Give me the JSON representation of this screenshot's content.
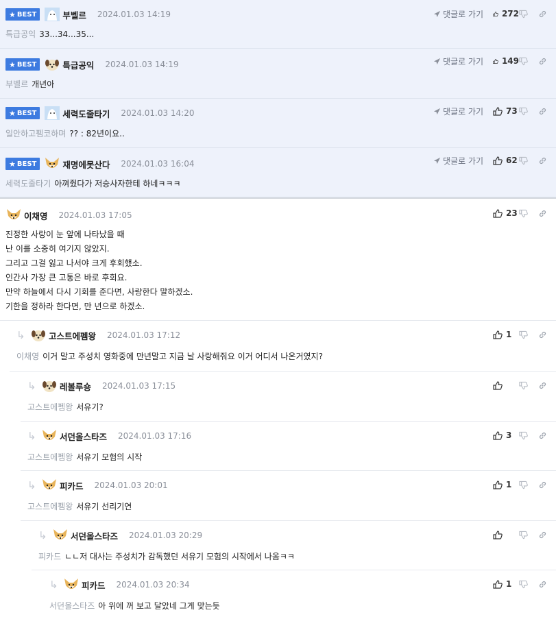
{
  "labels": {
    "best": "BEST",
    "goto": "댓글로 가기"
  },
  "colors": {
    "best_bg": "#eef2fb",
    "badge": "#3d7be0",
    "mention": "#9aa1ab"
  },
  "comments": [
    {
      "best": true,
      "avatar": "blue-dog",
      "nick": "부벨르",
      "date": "2024.01.03 14:19",
      "mention": "특급공익",
      "text": "33...34...35...",
      "likes": "272"
    },
    {
      "best": true,
      "avatar": "puppy",
      "nick": "특급공익",
      "date": "2024.01.03 14:19",
      "mention": "부벨르",
      "text": "개년아",
      "likes": "149"
    },
    {
      "best": true,
      "avatar": "blue-dog",
      "nick": "세력도줄타기",
      "date": "2024.01.03 14:20",
      "mention": "일안하고펨코하며",
      "text": "?? : 82년이요..",
      "likes": "73"
    },
    {
      "best": true,
      "avatar": "fox",
      "nick": "재명에못산다",
      "date": "2024.01.03 16:04",
      "mention": "세력도줄타기",
      "text": "아껴줬다가 저승사자한테 하네ㅋㅋㅋ",
      "likes": "62"
    },
    {
      "best": false,
      "avatar": "fox",
      "nick": "이채영",
      "date": "2024.01.03 17:05",
      "mention": "",
      "text": "진정한 사랑이 눈 앞에 나타났을 때\n난 이를 소중히 여기지 않았지.\n그리고 그걸 잃고 나서야 크게 후회했소.\n인간사 가장 큰 고통은 바로 후회요.\n만약 하늘에서 다시 기회를 준다면, 사랑한다 말하겠소.\n기한을 정하라 한다면, 만 년으로 하겠소.",
      "likes": "23"
    },
    {
      "best": false,
      "avatar": "puppy",
      "nick": "고스트에펨왕",
      "date": "2024.01.03 17:12",
      "mention": "이채영",
      "text": "이거 말고 주성치 영화중에 만년말고 지금 날 사랑해줘요 이거 어디서 나온거였지?",
      "likes": "1"
    },
    {
      "best": false,
      "avatar": "puppy",
      "nick": "레볼루숑",
      "date": "2024.01.03 17:15",
      "mention": "고스트에펨왕",
      "text": "서유기?",
      "likes": ""
    },
    {
      "best": false,
      "avatar": "fox",
      "nick": "서던올스타즈",
      "date": "2024.01.03 17:16",
      "mention": "고스트에펨왕",
      "text": "서유기 모험의 시작",
      "likes": "3"
    },
    {
      "best": false,
      "avatar": "fox",
      "nick": "피카드",
      "date": "2024.01.03 20:01",
      "mention": "고스트에펨왕",
      "text": "서유기 선리기연",
      "likes": "1"
    },
    {
      "best": false,
      "avatar": "fox",
      "nick": "서던올스타즈",
      "date": "2024.01.03 20:29",
      "mention": "피카드",
      "text": "ㄴㄴ저 대사는 주성치가 감독했던 서유기 모험의 시작에서 나옴ㅋㅋ",
      "likes": ""
    },
    {
      "best": false,
      "avatar": "fox",
      "nick": "피카드",
      "date": "2024.01.03 20:34",
      "mention": "서던올스타즈",
      "text": "아 위에 꺼 보고 달았네 그게 맞는듯",
      "likes": "1"
    }
  ]
}
